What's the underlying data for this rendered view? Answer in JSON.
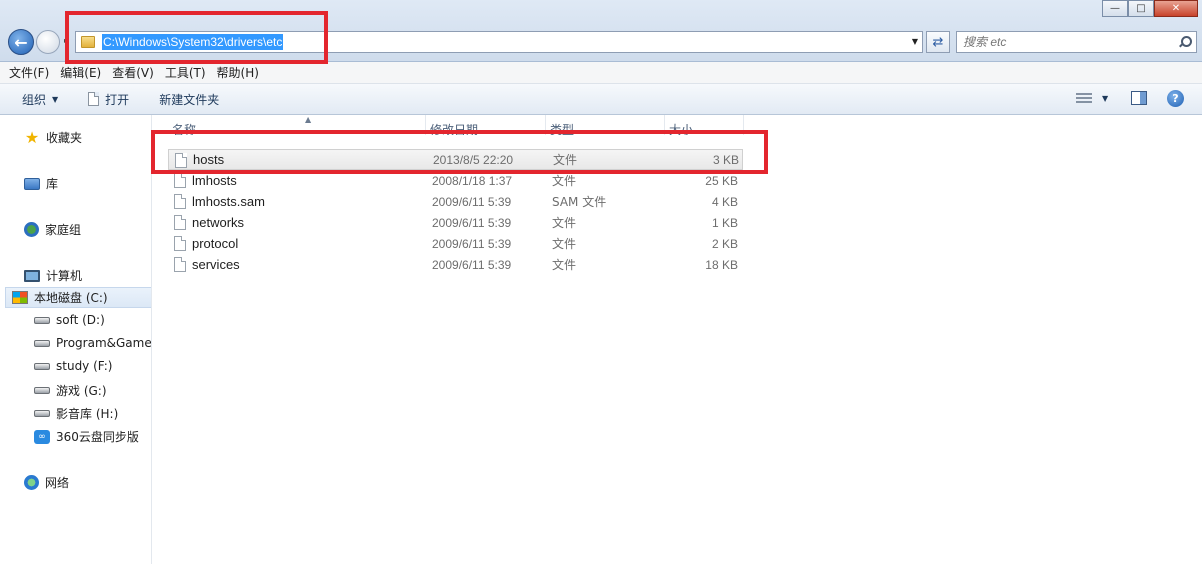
{
  "window": {
    "controls": {
      "minimize": "—",
      "maximize": "□",
      "close": "✕"
    }
  },
  "address": {
    "path": "C:\\Windows\\System32\\drivers\\etc",
    "back_icon": "back-arrow-icon",
    "refresh_icon": "refresh-icon"
  },
  "search": {
    "placeholder": "搜索 etc"
  },
  "menu": [
    "文件(F)",
    "编辑(E)",
    "查看(V)",
    "工具(T)",
    "帮助(H)"
  ],
  "toolbar": {
    "organize": "组织",
    "open": "打开",
    "new_folder": "新建文件夹",
    "help": "?"
  },
  "nav": {
    "favorites": "收藏夹",
    "libraries": "库",
    "homegroup": "家庭组",
    "computer": "计算机",
    "drives": [
      {
        "label": "本地磁盘 (C:)"
      },
      {
        "label": "soft (D:)"
      },
      {
        "label": "Program&Game"
      },
      {
        "label": "study (F:)"
      },
      {
        "label": "游戏 (G:)"
      },
      {
        "label": "影音库 (H:)"
      },
      {
        "label": "360云盘同步版"
      }
    ],
    "network": "网络"
  },
  "columns": {
    "name": "名称",
    "date": "修改日期",
    "type": "类型",
    "size": "大小"
  },
  "files": [
    {
      "name": "hosts",
      "date": "2013/8/5 22:20",
      "type": "文件",
      "size": "3 KB"
    },
    {
      "name": "lmhosts",
      "date": "2008/1/18 1:37",
      "type": "文件",
      "size": "25 KB"
    },
    {
      "name": "lmhosts.sam",
      "date": "2009/6/11 5:39",
      "type": "SAM 文件",
      "size": "4 KB"
    },
    {
      "name": "networks",
      "date": "2009/6/11 5:39",
      "type": "文件",
      "size": "1 KB"
    },
    {
      "name": "protocol",
      "date": "2009/6/11 5:39",
      "type": "文件",
      "size": "2 KB"
    },
    {
      "name": "services",
      "date": "2009/6/11 5:39",
      "type": "文件",
      "size": "18 KB"
    }
  ],
  "colors": {
    "annotation": "#e3262e",
    "selection": "#3399ff"
  }
}
